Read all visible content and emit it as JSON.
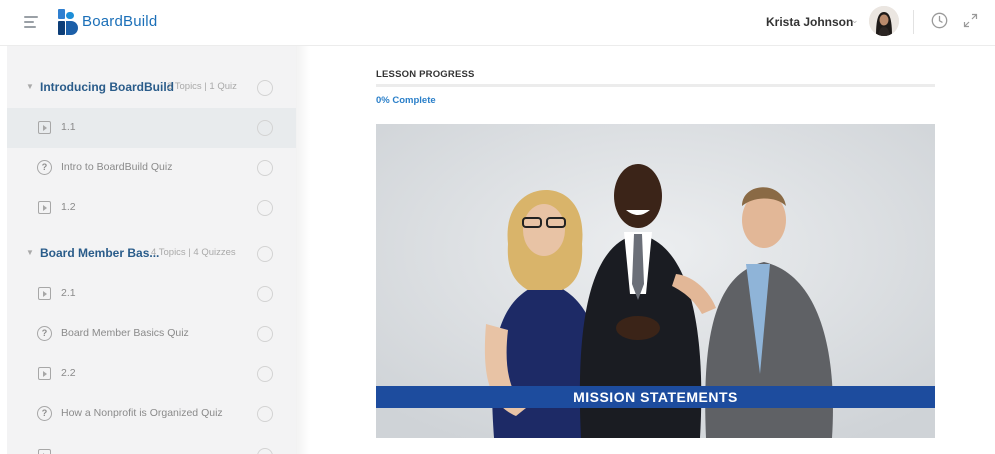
{
  "header": {
    "brand": "BoardBuild",
    "user_name": "Krista Johnson",
    "caret": "⌄"
  },
  "sidebar": {
    "sections": [
      {
        "title": "Introducing BoardBuild",
        "meta": "2 Topics  |  1 Quiz"
      },
      {
        "title": "Board Member Bas...",
        "meta": "4 Topics  |  4 Quizzes"
      }
    ],
    "items": [
      {
        "type": "topic",
        "label": "1.1",
        "active": true
      },
      {
        "type": "quiz",
        "label": "Intro to BoardBuild Quiz"
      },
      {
        "type": "topic",
        "label": "1.2"
      },
      {
        "type": "topic",
        "label": "2.1"
      },
      {
        "type": "quiz",
        "label": "Board Member Basics Quiz"
      },
      {
        "type": "topic",
        "label": "2.2"
      },
      {
        "type": "quiz",
        "label": "How a Nonprofit is Organized Quiz"
      }
    ],
    "quiz_glyph": "?"
  },
  "lesson": {
    "progress_heading": "LESSON PROGRESS",
    "progress_text": "0% Complete",
    "progress_fraction": 0
  },
  "video": {
    "banner_text": "MISSION STATEMENTS"
  },
  "colors": {
    "brand": "#1b6fb8",
    "link": "#2a7fc9",
    "section_title": "#2a5c8a",
    "banner": "#1f4fa3"
  }
}
